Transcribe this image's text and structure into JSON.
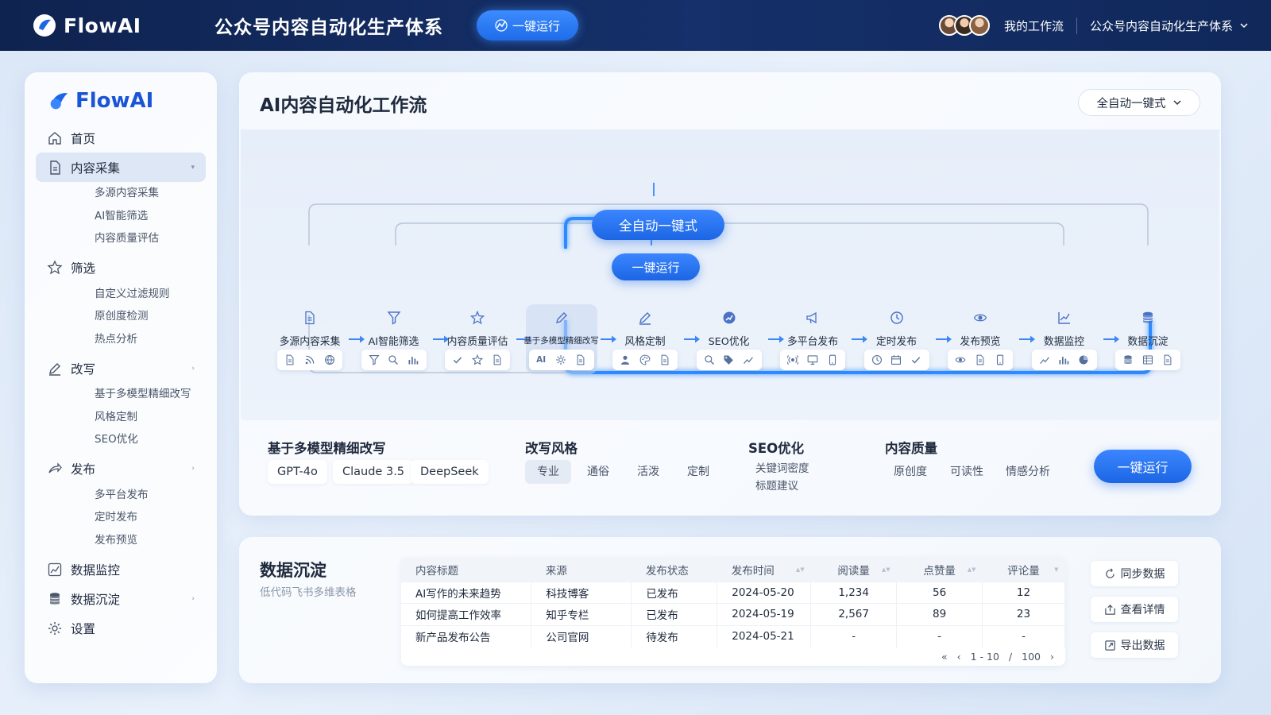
{
  "topbar": {
    "brand": "FlowAI",
    "title": "公众号内容自动化生产体系",
    "run_label": "一键运行",
    "my_flows": "我的工作流",
    "flow_select": "公众号内容自动化生产体系"
  },
  "sidebar": {
    "brand": "FlowAI",
    "nav": [
      {
        "label": "首页",
        "icon": "home-icon"
      },
      {
        "label": "内容采集",
        "icon": "document-icon",
        "subs": [
          "多源内容采集",
          "AI智能筛选",
          "内容质量评估"
        ]
      },
      {
        "label": "筛选",
        "icon": "star-icon",
        "subs": [
          "自定义过滤规则",
          "原创度检测",
          "热点分析"
        ]
      },
      {
        "label": "改写",
        "icon": "pencil-icon",
        "subs": [
          "基于多模型精细改写",
          "风格定制",
          "SEO优化"
        ]
      },
      {
        "label": "发布",
        "icon": "share-icon",
        "subs": [
          "多平台发布",
          "定时发布",
          "发布预览"
        ]
      },
      {
        "label": "数据监控",
        "icon": "chart-icon"
      },
      {
        "label": "数据沉淀",
        "icon": "database-icon"
      },
      {
        "label": "设置",
        "icon": "gear-icon"
      }
    ]
  },
  "main": {
    "title": "AI内容自动化工作流",
    "mode_select": "全自动一键式",
    "auto_pill": "全自动一键式",
    "run_pill": "一键运行",
    "steps": [
      {
        "label": "多源内容采集",
        "icon": "document-icon",
        "tools": [
          "file-icon",
          "rss-icon",
          "globe-icon"
        ]
      },
      {
        "label": "AI智能筛选",
        "icon": "funnel-icon",
        "tools": [
          "filter-icon",
          "search-icon",
          "bar-chart-icon"
        ]
      },
      {
        "label": "内容质量评估",
        "icon": "star-icon",
        "tools": [
          "check-icon",
          "star-icon",
          "file-icon"
        ]
      },
      {
        "label": "基于多模型精细改写",
        "icon": "pencil-icon",
        "tools": [
          "ai-icon",
          "gear-icon",
          "file-icon"
        ]
      },
      {
        "label": "风格定制",
        "icon": "brush-icon",
        "tools": [
          "user-icon",
          "palette-icon",
          "file-icon"
        ]
      },
      {
        "label": "SEO优化",
        "icon": "rocket-icon",
        "tools": [
          "search-icon",
          "tag-icon",
          "trend-icon"
        ]
      },
      {
        "label": "多平台发布",
        "icon": "megaphone-icon",
        "tools": [
          "broadcast-icon",
          "monitor-icon",
          "phone-icon"
        ]
      },
      {
        "label": "定时发布",
        "icon": "clock-icon",
        "tools": [
          "clock-icon",
          "calendar-icon",
          "check-icon"
        ]
      },
      {
        "label": "发布预览",
        "icon": "eye-icon",
        "tools": [
          "eye-icon",
          "file-icon",
          "phone-icon"
        ]
      },
      {
        "label": "数据监控",
        "icon": "line-chart-icon",
        "tools": [
          "trend-icon",
          "bar-chart-icon",
          "pie-chart-icon"
        ]
      },
      {
        "label": "数据沉淀",
        "icon": "database-icon",
        "tools": [
          "database-icon",
          "table-icon",
          "file-icon"
        ]
      }
    ],
    "ai_badge": "AI",
    "config": {
      "models_title": "基于多模型精细改写",
      "models": [
        "GPT-4o",
        "Claude 3.5",
        "DeepSeek"
      ],
      "style_title": "改写风格",
      "styles": [
        "专业",
        "通俗",
        "活泼",
        "定制"
      ],
      "seo_title": "SEO优化",
      "seo_items": [
        "关键词密度",
        "标题建议"
      ],
      "quality_title": "内容质量",
      "quality_items": [
        "原创度",
        "可读性",
        "情感分析"
      ],
      "run_label": "一键运行"
    }
  },
  "data": {
    "title": "数据沉淀",
    "subtitle": "低代码飞书多维表格",
    "columns": [
      "内容标题",
      "来源",
      "发布状态",
      "发布时间",
      "阅读量",
      "点赞量",
      "评论量"
    ],
    "rows": [
      [
        "AI写作的未来趋势",
        "科技博客",
        "已发布",
        "2024-05-20",
        "1,234",
        "56",
        "12"
      ],
      [
        "如何提高工作效率",
        "知乎专栏",
        "已发布",
        "2024-05-19",
        "2,567",
        "89",
        "23"
      ],
      [
        "新产品发布公告",
        "公司官网",
        "待发布",
        "2024-05-21",
        "-",
        "-",
        "-"
      ]
    ],
    "pager": {
      "range": "1 - 10",
      "sep": "/",
      "total": "100"
    },
    "buttons": {
      "sync": "同步数据",
      "detail": "查看详情",
      "export": "导出数据"
    }
  }
}
